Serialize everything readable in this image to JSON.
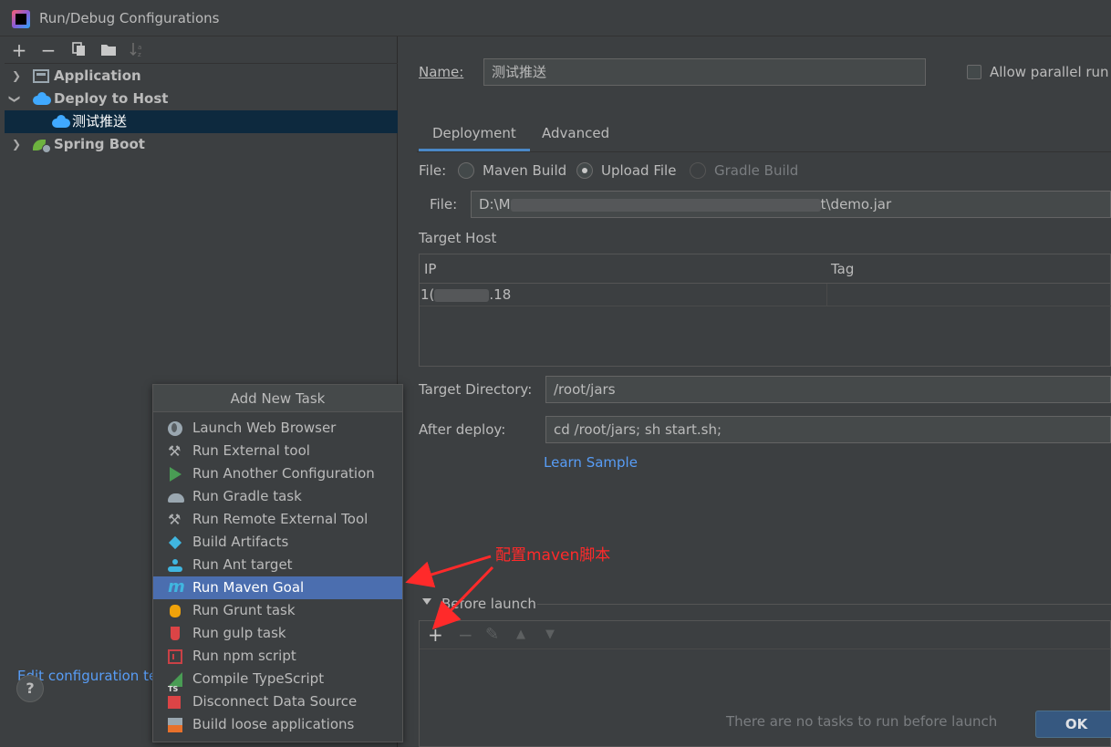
{
  "window": {
    "title": "Run/Debug Configurations"
  },
  "toolbar": {
    "add": "+",
    "remove": "−"
  },
  "tree": {
    "items": [
      {
        "label": "Application",
        "expanded": false,
        "icon": "application-icon"
      },
      {
        "label": "Deploy to Host",
        "expanded": true,
        "icon": "cloud-upload-icon"
      },
      {
        "label": "测试推送",
        "icon": "cloud-upload-icon",
        "selected": true
      },
      {
        "label": "Spring Boot",
        "expanded": false,
        "icon": "spring-boot-icon"
      }
    ]
  },
  "left_footer": {
    "edit_templates": "Edit configuration te",
    "help": "?"
  },
  "form": {
    "name_label": "Name:",
    "name_value": "测试推送",
    "allow_parallel": "Allow parallel run",
    "tabs": [
      {
        "label": "Deployment",
        "active": true
      },
      {
        "label": "Advanced",
        "active": false
      }
    ],
    "file_type_label": "File:",
    "file_type_options": [
      {
        "label": "Maven Build",
        "checked": false,
        "enabled": true
      },
      {
        "label": "Upload File",
        "checked": true,
        "enabled": true
      },
      {
        "label": "Gradle Build",
        "checked": false,
        "enabled": false
      }
    ],
    "file_label": "File:",
    "file_value_start": "D:\\M",
    "file_value_end": "t\\demo.jar",
    "target_host_label": "Target Host",
    "host_table": {
      "columns": [
        "IP",
        "Tag"
      ],
      "rows": [
        {
          "ip_start": "1(",
          "ip_end": ".18",
          "tag": ""
        }
      ]
    },
    "target_dir_label": "Target Directory:",
    "target_dir_value": "/root/jars",
    "after_deploy_label": "After deploy:",
    "after_deploy_value": "cd /root/jars; sh start.sh;",
    "learn_sample": "Learn Sample",
    "before_launch_title": "Before launch",
    "before_launch_toolbar": {
      "add": "+",
      "remove": "−",
      "edit": "✎",
      "up": "▲",
      "down": "▼"
    },
    "no_tasks": "There are no tasks to run before launch",
    "ok": "OK"
  },
  "popup": {
    "title": "Add New Task",
    "items": [
      {
        "label": "Launch Web Browser",
        "icon": "globe-icon"
      },
      {
        "label": "Run External tool",
        "icon": "tools-icon"
      },
      {
        "label": "Run Another Configuration",
        "icon": "run-icon"
      },
      {
        "label": "Run Gradle task",
        "icon": "gradle-icon"
      },
      {
        "label": "Run Remote External Tool",
        "icon": "tools-icon"
      },
      {
        "label": "Build Artifacts",
        "icon": "artifact-icon"
      },
      {
        "label": "Run Ant target",
        "icon": "ant-icon"
      },
      {
        "label": "Run Maven Goal",
        "icon": "maven-icon",
        "selected": true
      },
      {
        "label": "Run Grunt task",
        "icon": "grunt-icon"
      },
      {
        "label": "Run gulp task",
        "icon": "gulp-icon"
      },
      {
        "label": "Run npm script",
        "icon": "npm-icon"
      },
      {
        "label": "Compile TypeScript",
        "icon": "typescript-icon"
      },
      {
        "label": "Disconnect Data Source",
        "icon": "disconnect-icon"
      },
      {
        "label": "Build loose applications",
        "icon": "loose-app-icon"
      }
    ]
  },
  "annotation": {
    "text": "配置maven脚本",
    "color": "#ff2a2a"
  }
}
